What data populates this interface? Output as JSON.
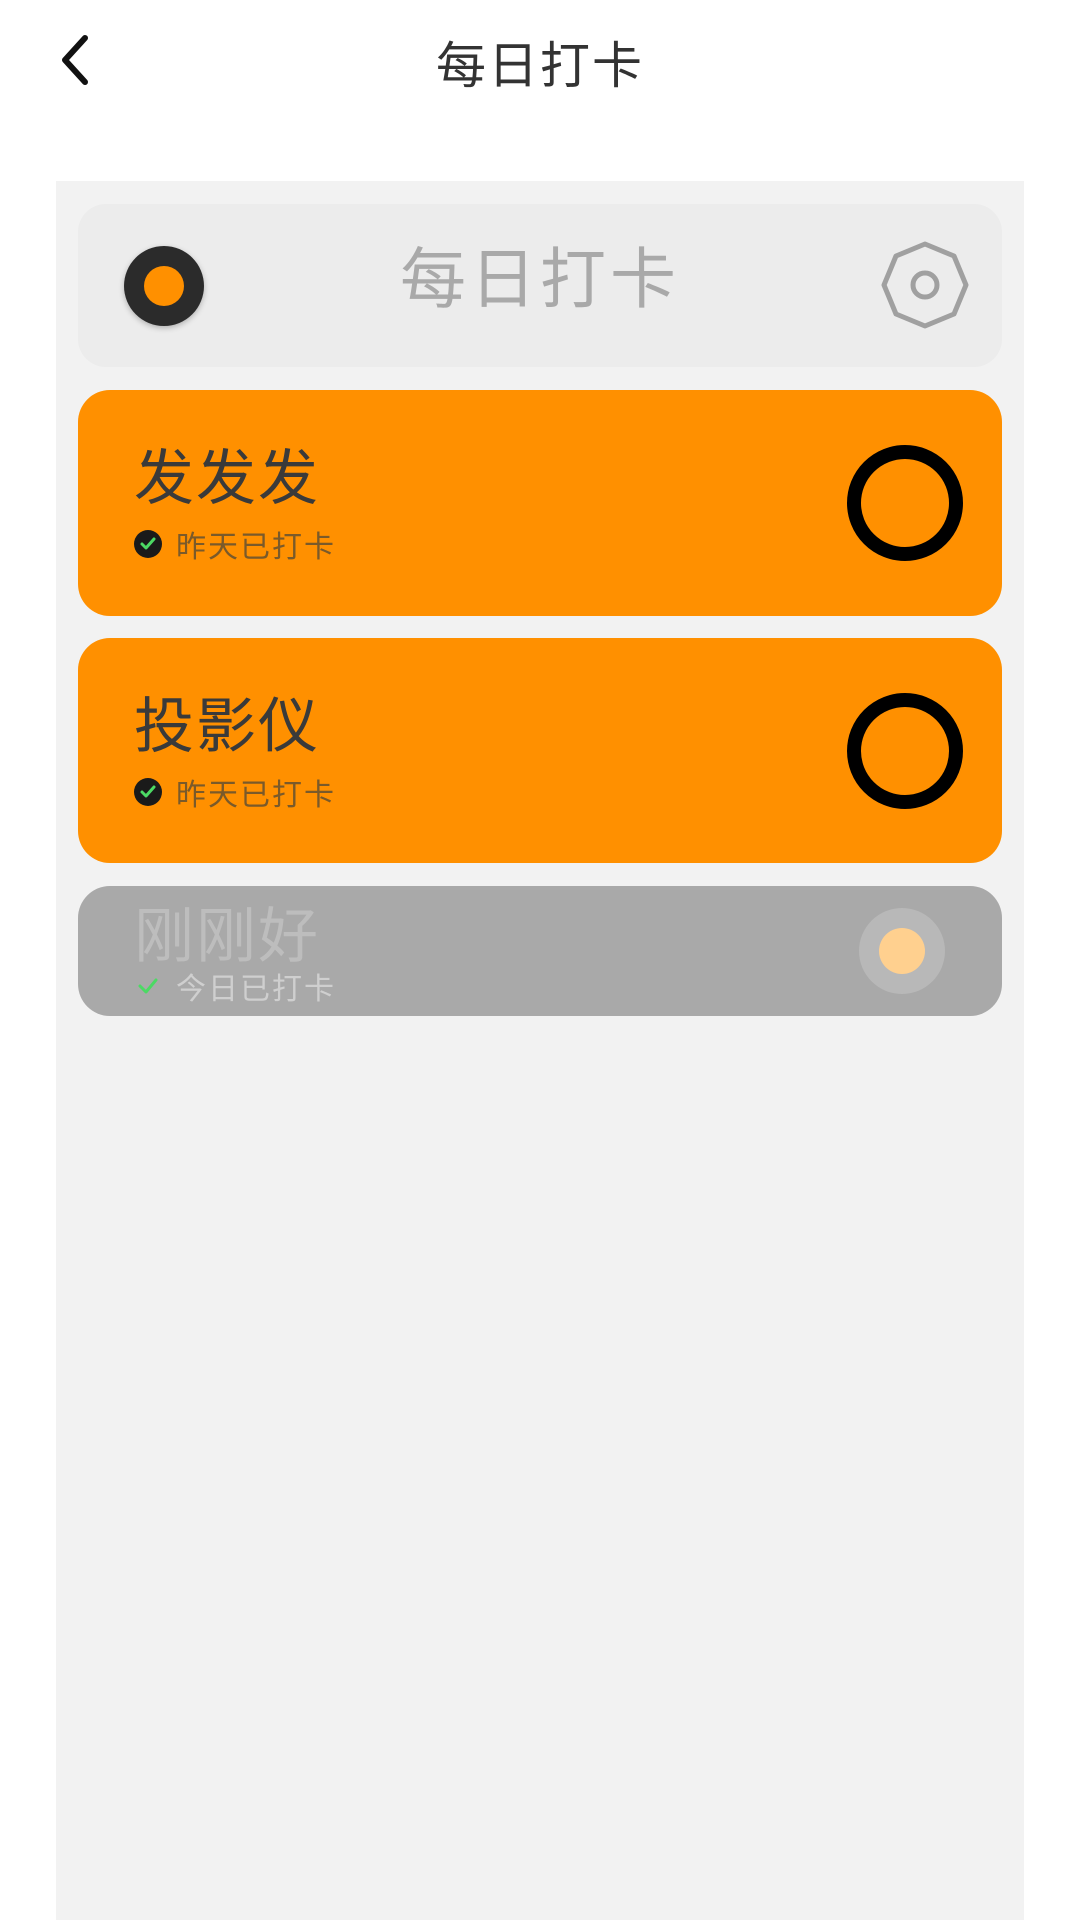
{
  "nav": {
    "title": "每日打卡",
    "back_icon": "chevron-left-icon"
  },
  "widget": {
    "title": "每日打卡",
    "settings_icon": "settings-icon"
  },
  "habits": [
    {
      "name": "发发发",
      "status": "昨天已打卡",
      "checked_today": false,
      "color": "#ff9000"
    },
    {
      "name": "投影仪",
      "status": "昨天已打卡",
      "checked_today": false,
      "color": "#ff9000"
    },
    {
      "name": "刚刚好",
      "status": "今日已打卡",
      "checked_today": true,
      "color": "#a9a9a9"
    }
  ],
  "colors": {
    "accent": "#ff9000",
    "panel_bg": "#f2f2f2",
    "done_card": "#a9a9a9",
    "check_green": "#4cd964"
  }
}
